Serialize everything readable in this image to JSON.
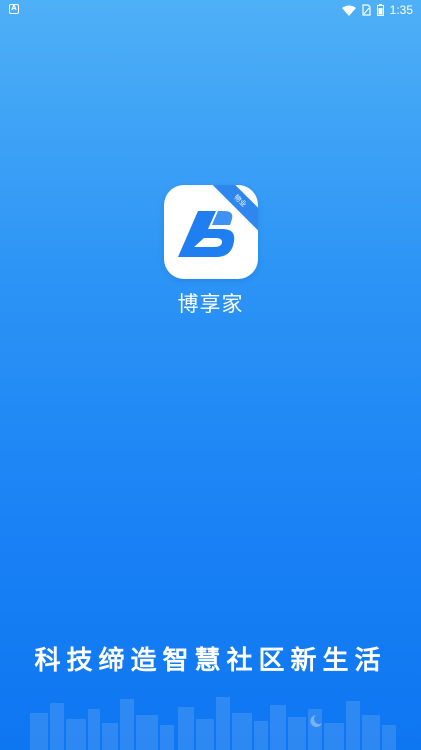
{
  "status_bar": {
    "time": "1:35",
    "icons": [
      "app-notification-icon",
      "wifi-icon",
      "sim-icon",
      "battery-icon"
    ]
  },
  "app": {
    "name": "博享家",
    "badge": "物业",
    "brand_color": "#1f7ff0",
    "logo_icon": "stylized-b-logo-icon"
  },
  "slogan": "科技缔造智慧社区新生活",
  "colors": {
    "background_top": "#4fb0f7",
    "background_bottom": "#0d76f1",
    "text": "#ffffff"
  }
}
